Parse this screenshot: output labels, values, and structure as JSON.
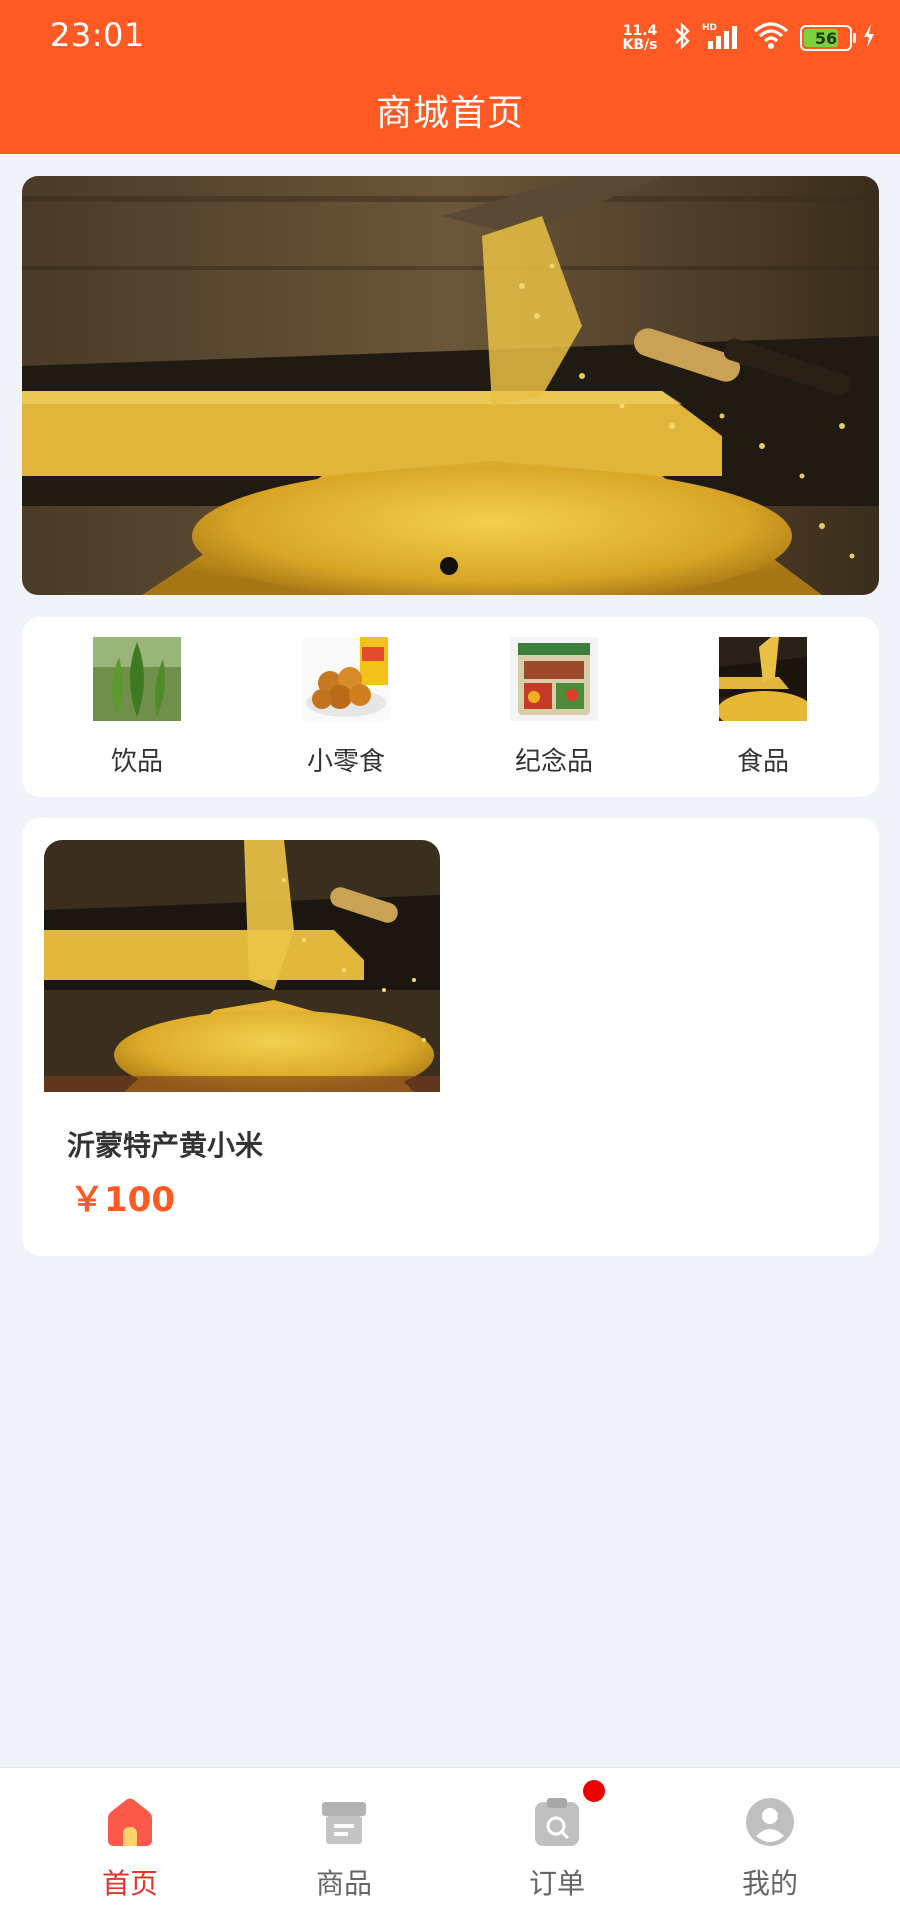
{
  "status_bar": {
    "time": "23:01",
    "net_speed_value": "11.4",
    "net_speed_unit": "KB/s",
    "battery": "56"
  },
  "header": {
    "title": "商城首页"
  },
  "banner": {
    "image": "millet-banner",
    "active_slide": 1
  },
  "categories": [
    {
      "label": "饮品",
      "icon": "tea-leaf-image"
    },
    {
      "label": "小零食",
      "icon": "snack-image"
    },
    {
      "label": "纪念品",
      "icon": "souvenir-image"
    },
    {
      "label": "食品",
      "icon": "millet-image"
    }
  ],
  "product": {
    "name": "沂蒙特产黄小米",
    "price": "￥100",
    "image": "millet-product-image"
  },
  "tabbar": {
    "items": [
      {
        "label": "首页",
        "icon": "home-icon",
        "active": true
      },
      {
        "label": "商品",
        "icon": "goods-icon",
        "active": false
      },
      {
        "label": "订单",
        "icon": "order-icon",
        "active": false,
        "badge": true
      },
      {
        "label": "我的",
        "icon": "profile-icon",
        "active": false
      }
    ]
  },
  "colors": {
    "accent": "#ff5a24",
    "active_tab": "#e4372c",
    "background": "#f0f3f8"
  }
}
